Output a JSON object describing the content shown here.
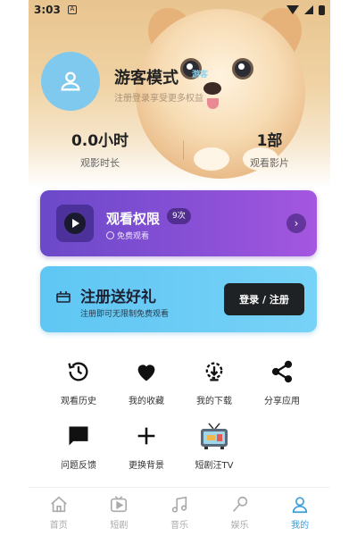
{
  "status_bar": {
    "time": "3:03",
    "sim_label": "A"
  },
  "profile": {
    "username": "游客模式",
    "guest_tag": "游客",
    "login_hint": "注册登录享受更多权益"
  },
  "stats": [
    {
      "value": "0.0小时",
      "label": "观影时长"
    },
    {
      "value": "1部",
      "label": "观看影片"
    }
  ],
  "vip_card": {
    "title": "观看权限",
    "badge": "9次",
    "subtitle": "免费观看",
    "arrow": "›"
  },
  "register_card": {
    "title": "注册送好礼",
    "subtitle": "注册即可无限制免费观看",
    "button": "登录 / 注册"
  },
  "grid": [
    {
      "label": "观看历史",
      "icon": "history-icon"
    },
    {
      "label": "我的收藏",
      "icon": "heart-icon"
    },
    {
      "label": "我的下载",
      "icon": "download-icon"
    },
    {
      "label": "分享应用",
      "icon": "share-icon"
    },
    {
      "label": "问题反馈",
      "icon": "feedback-icon"
    },
    {
      "label": "更换背景",
      "icon": "plus-icon"
    },
    {
      "label": "短剧汪TV",
      "icon": "tv-icon"
    }
  ],
  "tabs": [
    {
      "label": "首页",
      "icon": "home-icon",
      "active": false
    },
    {
      "label": "短剧",
      "icon": "play-square-icon",
      "active": false
    },
    {
      "label": "音乐",
      "icon": "music-icon",
      "active": false
    },
    {
      "label": "娱乐",
      "icon": "mic-icon",
      "active": false
    },
    {
      "label": "我的",
      "icon": "user-icon",
      "active": true
    }
  ],
  "colors": {
    "accent": "#3a9bd9",
    "vip_gradient_start": "#6b49c9",
    "vip_gradient_end": "#a557e0",
    "register_card": "#6ccdf5",
    "avatar_bg": "#7fc9ee"
  }
}
